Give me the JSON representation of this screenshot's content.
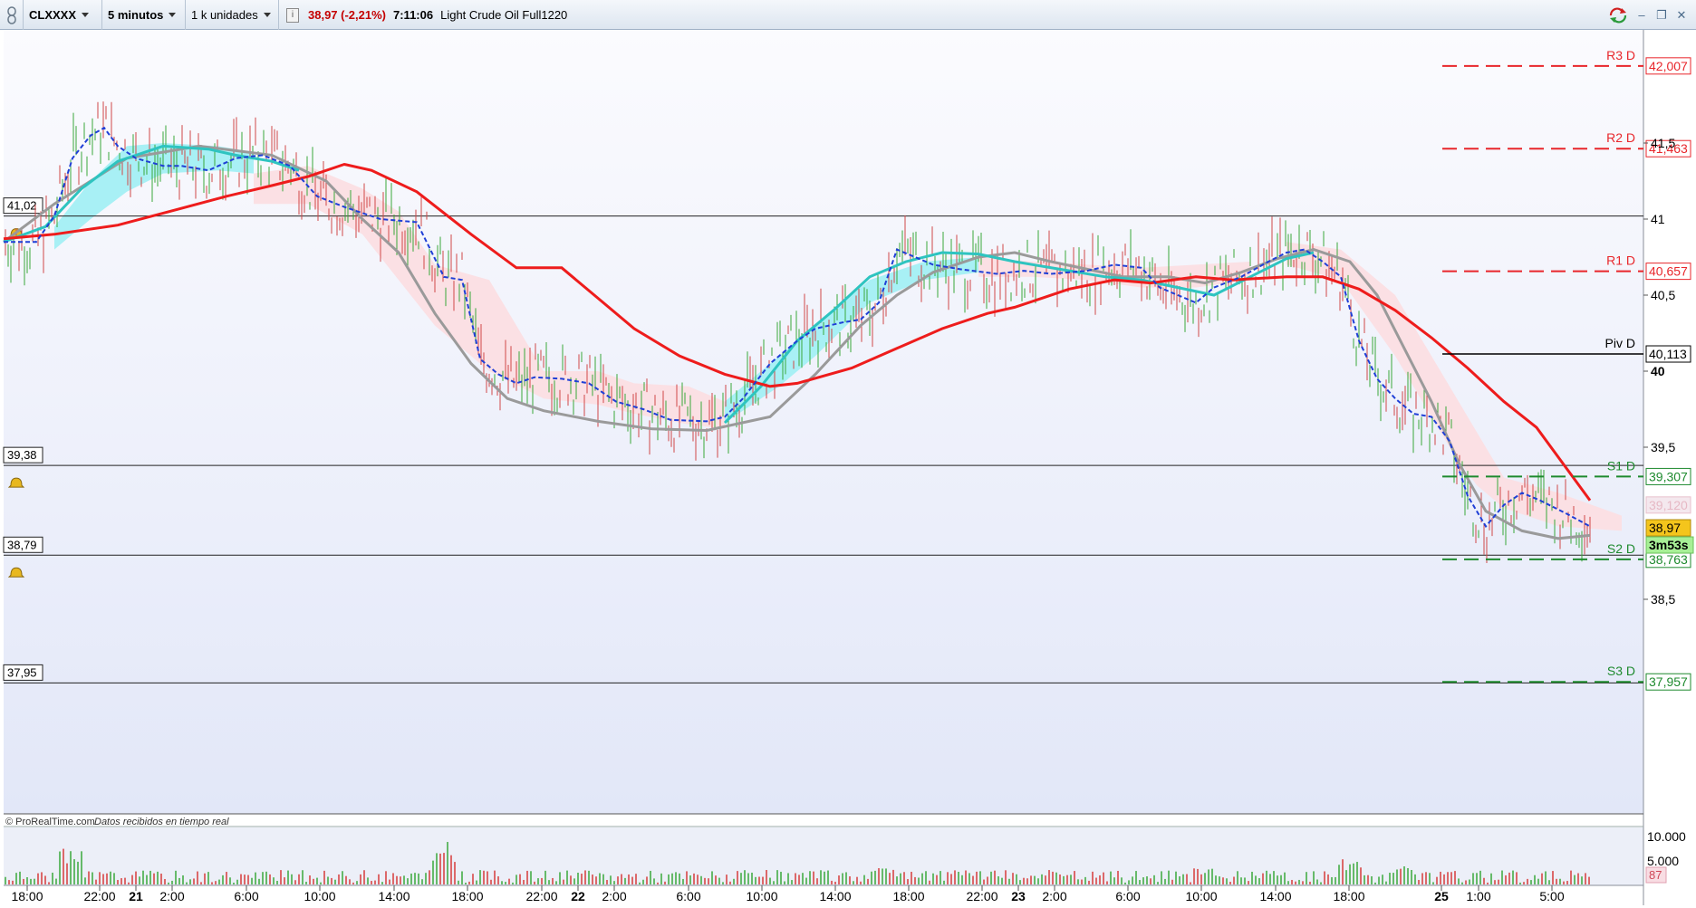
{
  "toolbar": {
    "symbol": "CLXXXX",
    "timeframe": "5 minutos",
    "units": "1 k unidades",
    "price_change": "38,97 (-2,21%)",
    "time": "7:11:06",
    "instrument": "Light Crude Oil Full1220"
  },
  "chart": {
    "credit": "© ProRealTime.com",
    "credit_note": "Datos recibidos en tiempo real",
    "countdown": "3m53s",
    "current_price": "38,97",
    "faded_price": "39,120",
    "left_levels": [
      "41,02",
      "39,38",
      "38,79",
      "37,95"
    ],
    "pivots": [
      {
        "name": "R3 D",
        "value": "42,007",
        "color": "#e8262b"
      },
      {
        "name": "R2 D",
        "value": "41,463",
        "color": "#e8262b"
      },
      {
        "name": "R1 D",
        "value": "40,657",
        "color": "#e8262b"
      },
      {
        "name": "Piv D",
        "value": "40,113",
        "color": "#000000"
      },
      {
        "name": "S1 D",
        "value": "39,307",
        "color": "#1e8a2e"
      },
      {
        "name": "S2 D",
        "value": "38,763",
        "color": "#1e8a2e"
      },
      {
        "name": "S3 D",
        "value": "37,957",
        "color": "#1e8a2e"
      }
    ],
    "y_ticks": [
      {
        "label": "41,5",
        "bold": false
      },
      {
        "label": "41",
        "bold": false
      },
      {
        "label": "40,5",
        "bold": false
      },
      {
        "label": "40",
        "bold": true
      },
      {
        "label": "39,5",
        "bold": false
      },
      {
        "label": "38,5",
        "bold": false
      }
    ],
    "volume_ticks": [
      "10.000",
      "5.000",
      "87"
    ],
    "x_ticks": [
      {
        "label": "18:00",
        "bold": false
      },
      {
        "label": "22:00",
        "bold": false
      },
      {
        "label": "21",
        "bold": true
      },
      {
        "label": "2:00",
        "bold": false
      },
      {
        "label": "6:00",
        "bold": false
      },
      {
        "label": "10:00",
        "bold": false
      },
      {
        "label": "14:00",
        "bold": false
      },
      {
        "label": "18:00",
        "bold": false
      },
      {
        "label": "22:00",
        "bold": false
      },
      {
        "label": "22",
        "bold": true
      },
      {
        "label": "2:00",
        "bold": false
      },
      {
        "label": "6:00",
        "bold": false
      },
      {
        "label": "10:00",
        "bold": false
      },
      {
        "label": "14:00",
        "bold": false
      },
      {
        "label": "18:00",
        "bold": false
      },
      {
        "label": "22:00",
        "bold": false
      },
      {
        "label": "23",
        "bold": true
      },
      {
        "label": "2:00",
        "bold": false
      },
      {
        "label": "6:00",
        "bold": false
      },
      {
        "label": "10:00",
        "bold": false
      },
      {
        "label": "14:00",
        "bold": false
      },
      {
        "label": "18:00",
        "bold": false
      },
      {
        "label": "25",
        "bold": true
      },
      {
        "label": "1:00",
        "bold": false
      },
      {
        "label": "5:00",
        "bold": false
      }
    ],
    "colors": {
      "price_bar": "#8a8a8a",
      "ema_red": "#ee1c1c",
      "ma_gray": "#9a9a9a",
      "ma_cyan": "#2ec4c0",
      "signal_blue": "#1f3fd6",
      "cloud_cyan": "#a8f0f5",
      "cloud_pink": "#fbe0e4",
      "volume_up": "#3aa83a",
      "volume_down": "#d63a3a"
    }
  }
}
